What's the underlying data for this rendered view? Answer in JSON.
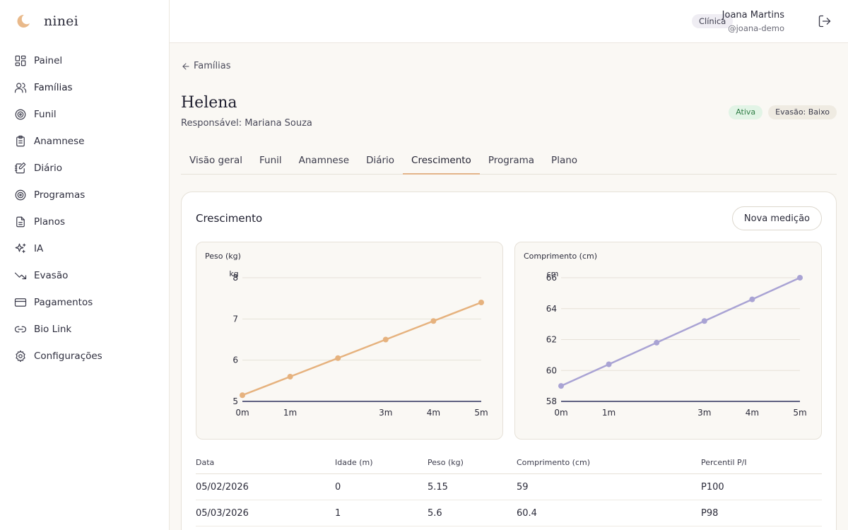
{
  "app": {
    "name": "ninei"
  },
  "sidebar": {
    "items": [
      {
        "label": "Painel",
        "icon": "dashboard-icon"
      },
      {
        "label": "Famílias",
        "icon": "users-icon"
      },
      {
        "label": "Funil",
        "icon": "target-icon"
      },
      {
        "label": "Anamnese",
        "icon": "clipboard-icon"
      },
      {
        "label": "Diário",
        "icon": "notebook-icon"
      },
      {
        "label": "Programas",
        "icon": "target-icon"
      },
      {
        "label": "Planos",
        "icon": "document-icon"
      },
      {
        "label": "IA",
        "icon": "sparkles-icon"
      },
      {
        "label": "Evasão",
        "icon": "trending-down-icon"
      },
      {
        "label": "Pagamentos",
        "icon": "credit-card-icon"
      },
      {
        "label": "Bio Link",
        "icon": "link-icon"
      },
      {
        "label": "Configurações",
        "icon": "gear-icon"
      }
    ]
  },
  "topbar": {
    "role": "Clínica",
    "user_name": "Joana Martins",
    "user_handle": "@joana-demo"
  },
  "page": {
    "back_label": "Famílias",
    "child_name": "Helena",
    "responsible": "Responsável: Mariana Souza",
    "status_badge": "Ativa",
    "churn_badge": "Evasão: Baixo"
  },
  "tabs": [
    "Visão geral",
    "Funil",
    "Anamnese",
    "Diário",
    "Crescimento",
    "Programa",
    "Plano"
  ],
  "card": {
    "title": "Crescimento",
    "new_button": "Nova medição"
  },
  "chart_data": [
    {
      "type": "line",
      "title": "Peso (kg)",
      "ylabel": "kg",
      "x": [
        0,
        1,
        2,
        3,
        4,
        5
      ],
      "xticks": [
        0,
        1,
        3,
        4,
        5
      ],
      "xtick_labels": [
        "0m",
        "1m",
        "3m",
        "4m",
        "5m"
      ],
      "yticks": [
        5,
        6,
        7,
        8
      ],
      "ylim": [
        5,
        8
      ],
      "series": [
        {
          "values": [
            5.15,
            5.6,
            6.05,
            6.5,
            6.95,
            7.4
          ]
        }
      ],
      "color": "#e6b27e",
      "grid": true
    },
    {
      "type": "line",
      "title": "Comprimento (cm)",
      "ylabel": "cm",
      "x": [
        0,
        1,
        2,
        3,
        4,
        5
      ],
      "xticks": [
        0,
        1,
        3,
        4,
        5
      ],
      "xtick_labels": [
        "0m",
        "1m",
        "3m",
        "4m",
        "5m"
      ],
      "yticks": [
        58,
        60,
        62,
        64,
        66
      ],
      "ylim": [
        58,
        66
      ],
      "series": [
        {
          "values": [
            59,
            60.4,
            61.8,
            63.2,
            64.6,
            66
          ]
        }
      ],
      "color": "#a9a3d4",
      "grid": true
    }
  ],
  "table": {
    "headers": [
      "Data",
      "Idade (m)",
      "Peso (kg)",
      "Comprimento (cm)",
      "Percentil P/I"
    ],
    "rows": [
      [
        "05/02/2026",
        "0",
        "5.15",
        "59",
        "P100"
      ],
      [
        "05/03/2026",
        "1",
        "5.6",
        "60.4",
        "P98"
      ]
    ]
  },
  "colors": {
    "accent": "#e3b489",
    "axis": "#2b2e5a",
    "grid": "#e6e1d8"
  }
}
